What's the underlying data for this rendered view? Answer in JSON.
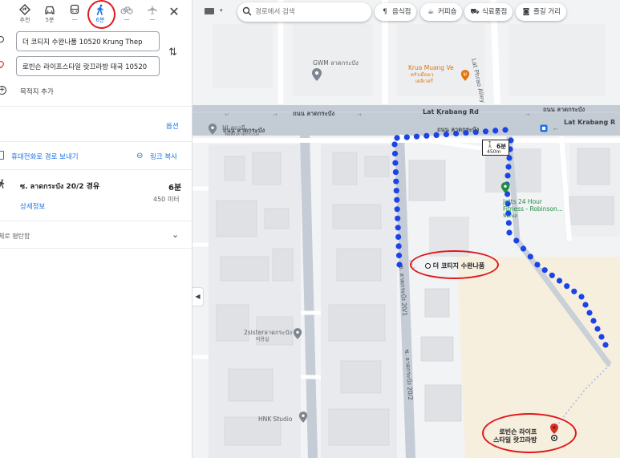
{
  "colors": {
    "accent": "#1a73e8",
    "route": "#1a44e6",
    "annotation": "#e0191b",
    "road": "#c6cdd6"
  },
  "modes": [
    {
      "name": "best",
      "icon": "diamond-route-icon",
      "label": "추천"
    },
    {
      "name": "driving",
      "icon": "car-icon",
      "label": "5분"
    },
    {
      "name": "transit",
      "icon": "bus-icon",
      "label": "—"
    },
    {
      "name": "walking",
      "icon": "walk-icon",
      "label": "6분"
    },
    {
      "name": "cycling",
      "icon": "bicycle-icon",
      "label": "—"
    },
    {
      "name": "flight",
      "icon": "plane-icon",
      "label": "—"
    }
  ],
  "route": {
    "origin": "더 코티지 수완나품 10520 Krung Thep",
    "destination": "로빈슨 라이프스타일 랏끄라방 태국 10520",
    "add_stop": "목적지 추가",
    "options": "옵션",
    "send_to_phone": "휴대전화로 경로 보내기",
    "copy_link": "링크 복사",
    "via": "ซ. ลาดกระบัง 20/2 경유",
    "time": "6분",
    "distance": "450 미터",
    "details": "상세정보",
    "flat": "체로 평탄함"
  },
  "search": {
    "placeholder": "경로에서 검색"
  },
  "chips": [
    {
      "icon": "fork-knife-icon",
      "glyph": "¶",
      "label": "음식점"
    },
    {
      "icon": "coffee-icon",
      "glyph": "☕",
      "label": "커피숍"
    },
    {
      "icon": "cart-icon",
      "glyph": "⛟",
      "label": "식료품점"
    },
    {
      "icon": "camera-icon",
      "glyph": "◙",
      "label": "즐길 거리"
    }
  ],
  "map": {
    "roads": [
      "Lat Krabang Rd",
      "ถนน ลาดกระบัง",
      "ถนน ลาดกระบัง",
      "ถนน ลาดกระบัง",
      "ถนน ลาดกระบัง",
      "Lat Krabang R"
    ],
    "alley": "Lat Phrao Alley",
    "soi1": "ซ. ลาดกระบัง 20/1",
    "soi2": "ซ. ลาดกระบัง 20/2",
    "pois": {
      "gwm": "GWM ลาดกระบัง",
      "krua1": "Krua Muang Ve",
      "krua2": "ครัวเมืองเว",
      "krua3": "เดลิเวอรี่",
      "hi": "HI สถานี",
      "hi2": "หอพักลาดกระบัง",
      "jetts1": "Jetts 24 Hour",
      "jetts2": "Fitness - Robinson...",
      "jetts3": "ฟิตเนส",
      "sister1": "2sisterลาดกระบัง",
      "sister2": "미용실",
      "hnk": "HNK Studio",
      "cottage": "더 코티지 수완나품",
      "robinson1": "로빈슨 라이프",
      "robinson2": "스타일 랏끄라방"
    },
    "walk_badge": {
      "time": "6분",
      "distance": "450m"
    }
  }
}
